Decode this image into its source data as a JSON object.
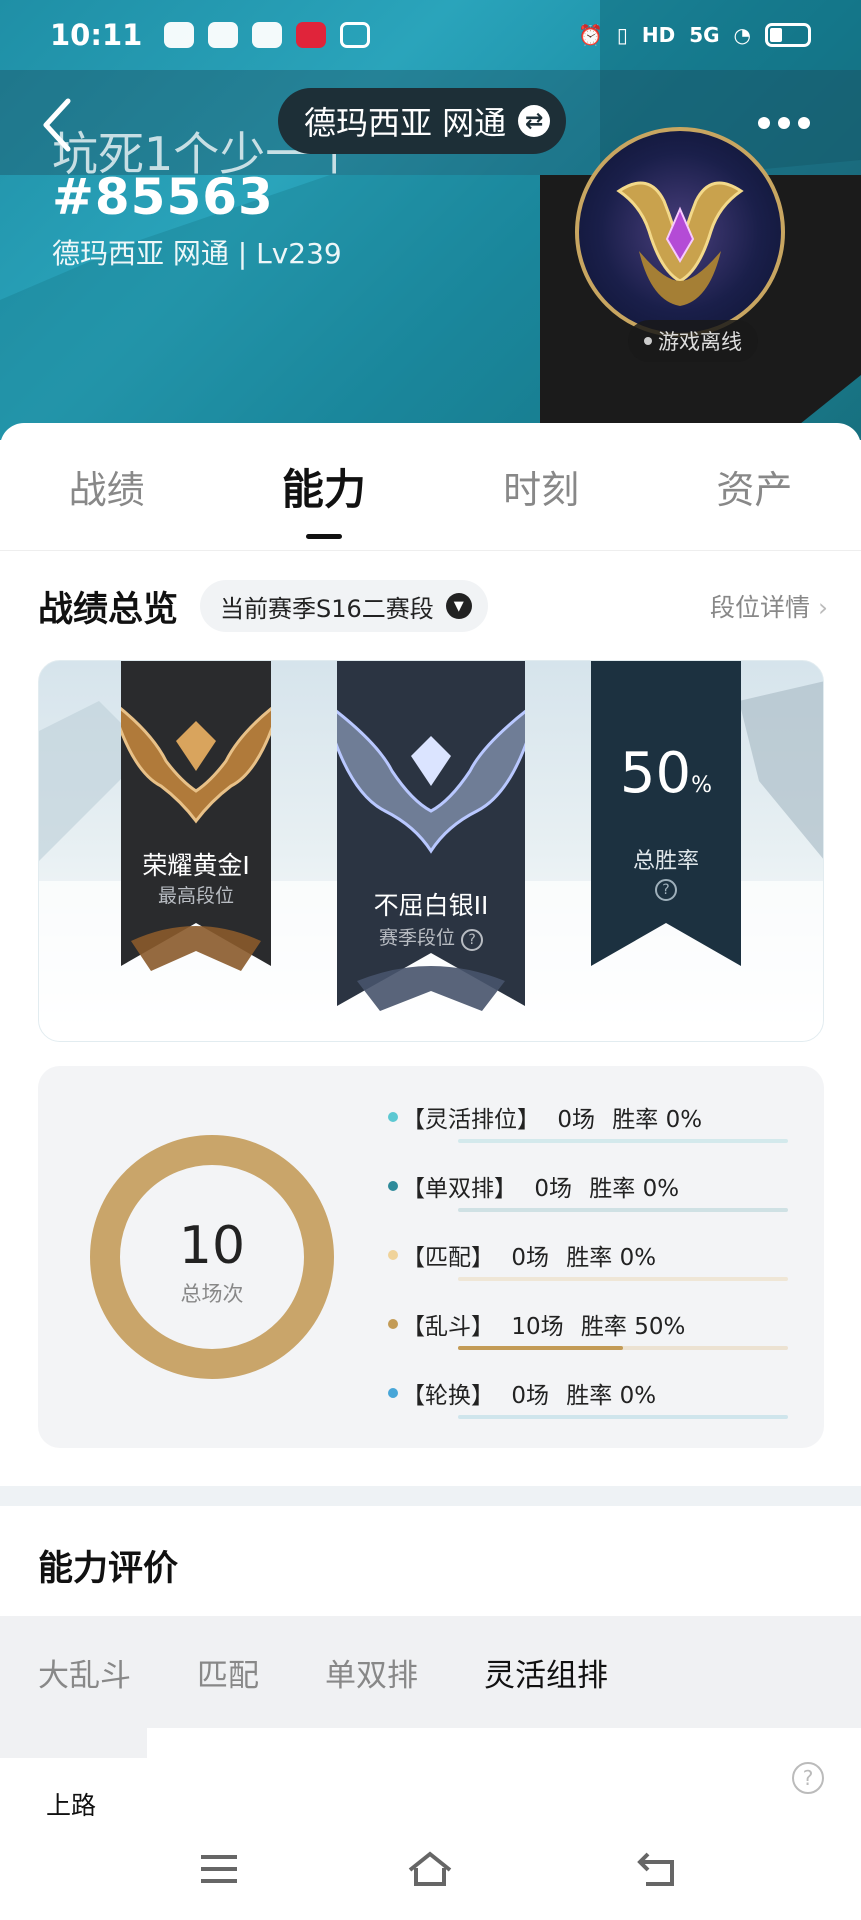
{
  "status_bar": {
    "time": "10:11",
    "network_label": "5G",
    "hd_label": "HD"
  },
  "header": {
    "server_pill": "德玛西亚 网通",
    "player_name": "坑死1个少一个",
    "player_tag": "#85563",
    "player_sub": "德玛西亚 网通 | Lv239",
    "status_badge": "游戏离线",
    "icons": {
      "back": "back-arrow-icon",
      "swap": "swap-icon",
      "more": "more-dots-icon"
    }
  },
  "tabs": [
    {
      "label": "战绩",
      "active": false
    },
    {
      "label": "能力",
      "active": true
    },
    {
      "label": "时刻",
      "active": false
    },
    {
      "label": "资产",
      "active": false
    }
  ],
  "overview": {
    "title": "战绩总览",
    "season_selector": "当前赛季S16二赛段",
    "rank_detail_link": "段位详情",
    "highest_rank": {
      "name": "荣耀黄金I",
      "label": "最高段位"
    },
    "season_rank": {
      "name": "不屈白银II",
      "label": "赛季段位"
    },
    "win_rate": {
      "value": "50",
      "unit": "%",
      "label": "总胜率"
    }
  },
  "stats": {
    "total_value": "10",
    "total_label": "总场次",
    "modes": [
      {
        "name": "【灵活排位】",
        "games": "0场",
        "rate_text": "胜率 0%",
        "rate": 0,
        "color": "#5cc8d2",
        "track": "#d3e9ec"
      },
      {
        "name": "【单双排】",
        "games": "0场",
        "rate_text": "胜率 0%",
        "rate": 0,
        "color": "#2e8a9a",
        "track": "#cfe1e4"
      },
      {
        "name": "【匹配】",
        "games": "0场",
        "rate_text": "胜率 0%",
        "rate": 0,
        "color": "#f0d39a",
        "track": "#efe6d6"
      },
      {
        "name": "【乱斗】",
        "games": "10场",
        "rate_text": "胜率 50%",
        "rate": 0.5,
        "color": "#c39b56",
        "track": "#ece2d2"
      },
      {
        "name": "【轮换】",
        "games": "0场",
        "rate_text": "胜率 0%",
        "rate": 0,
        "color": "#48a6d8",
        "track": "#cfe5ec"
      }
    ],
    "donut_color": "#c9a56a"
  },
  "ability": {
    "title": "能力评价",
    "tabs": [
      {
        "label": "大乱斗",
        "active": false
      },
      {
        "label": "匹配",
        "active": false
      },
      {
        "label": "单双排",
        "active": false
      },
      {
        "label": "灵活组排",
        "active": true
      }
    ],
    "lane": "上路"
  },
  "colors": {
    "header_teal": "#1f8fa6",
    "gold_ring": "#c8a661",
    "text_primary": "#111111",
    "text_muted": "#888888"
  }
}
